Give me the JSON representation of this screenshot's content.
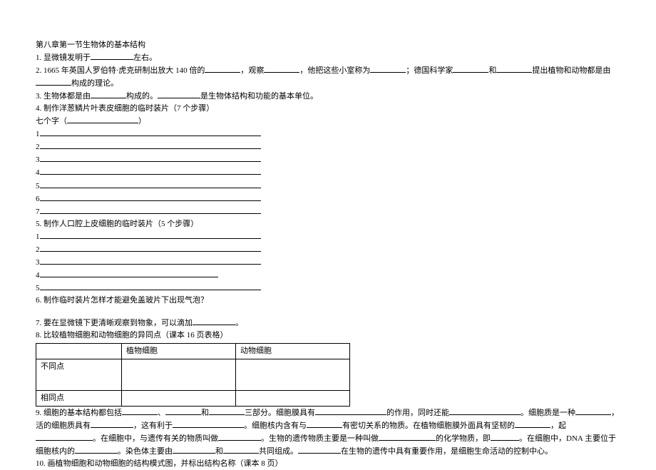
{
  "title": "第八章第一节生物体的基本结构",
  "q1": {
    "prefix": "1. 显微镜发明于",
    "suffix": "左右。"
  },
  "q2": {
    "p1": "2. 1665 年英国人罗伯特·虎克研制出放大 140 倍的",
    "p2": "，观察",
    "p3": "，他把这些小室称为",
    "p4": "；德国科学家",
    "p5": "和",
    "p6": "提出植物和动物都是由",
    "p7": "构成的理论。"
  },
  "q3": {
    "p1": "3. 生物体都是由",
    "p2": "构成的。",
    "p3": "是生物体结构和功能的基本单位。"
  },
  "q4": {
    "title": "4. 制作洋葱鳞片叶表皮细胞的临时装片（7 个步骤）",
    "seven": "七个字（",
    "seven_end": "）",
    "n1": "1",
    "n2": "2",
    "n3": "3",
    "n4": "4",
    "n5": "5",
    "n6": "6",
    "n7": "7"
  },
  "q5": {
    "title": "5. 制作人口腔上皮细胞的临时装片（5 个步骤）",
    "n1": "1",
    "n2": "2",
    "n3": "3",
    "n4": "4",
    "n5": "5"
  },
  "q6": "6. 制作临时装片怎样才能避免盖玻片下出现气泡？",
  "q7": {
    "p1": "7. 要在显微镜下更清晰观察到物象，可以滴加",
    "p2": "。"
  },
  "q8": {
    "title": "8. 比较植物细胞和动物细胞的异同点（课本 16 页表格）",
    "col_plant": "植物细胞",
    "col_animal": "动物细胞",
    "row_diff": "不同点",
    "row_same": "相同点"
  },
  "q9": {
    "p1": "9. 细胞的基本结构都包括",
    "p2": "、",
    "p3": "和",
    "p4": "三部分。细胞膜具有",
    "p5": "的作用，同时还能",
    "p6": "。细胞质是一种",
    "p7": "，活的细胞质具有",
    "p8": "，这有利于",
    "p9": "。细胞核内含有与",
    "p10": "有密切关系的物质。在植物细胞膜外面具有坚韧的",
    "p11": "，起",
    "p12": "。在细胞中，与遗传有关的物质叫做",
    "p13": "。生物的遗传物质主要是一种叫做",
    "p14": "的化学物质，即",
    "p15": "。在细胞中，DNA 主要位于细胞核内的",
    "p16": "。染色体主要由",
    "p17": "和",
    "p18": "共同组成。",
    "p19": "在生物的遗传中具有重要作用，是细胞生命活动的控制中心。"
  },
  "q10": "10. 画植物细胞和动物细胞的结构模式图，并标出结构名称（课本 8 页）"
}
